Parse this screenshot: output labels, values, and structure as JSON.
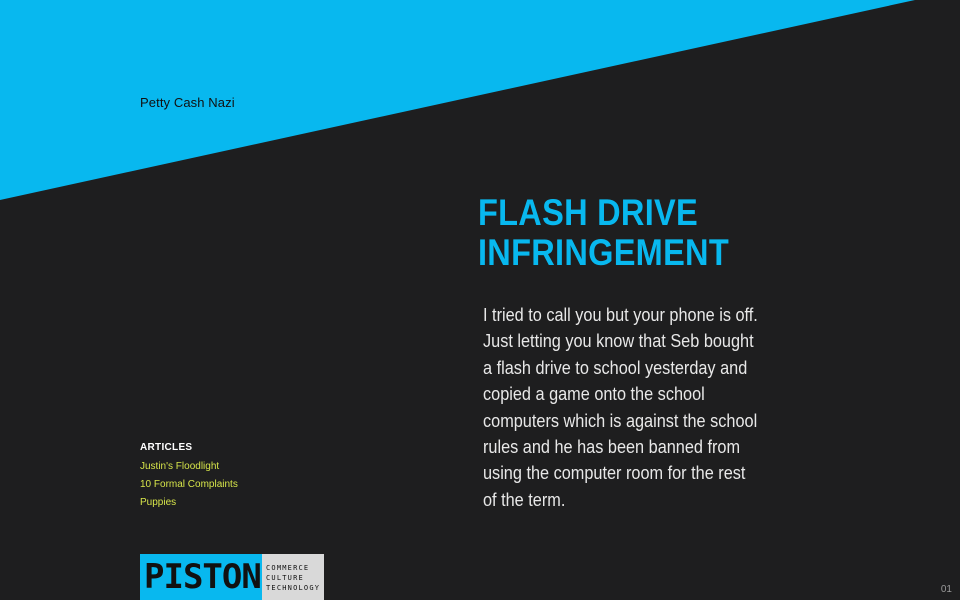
{
  "colors": {
    "background": "#1e1e1f",
    "accent": "#08b8ef",
    "link": "#d7e54a",
    "body_text": "#e8e8e8"
  },
  "header": {
    "section_name": "Petty Cash Nazi"
  },
  "article": {
    "headline": "FLASH DRIVE\nINFRINGEMENT",
    "body": "I tried to call you but your phone is off.\nJust letting you know that Seb bought\na flash drive to school yesterday and\ncopied a game onto the school\ncomputers which is against the school\nrules and he has been banned from\nusing the computer room for the rest\nof the term."
  },
  "sidebar": {
    "heading": "ARTICLES",
    "links": [
      {
        "label": "Justin's Floodlight"
      },
      {
        "label": "10 Formal Complaints"
      },
      {
        "label": "Puppies"
      }
    ]
  },
  "logo": {
    "wordmark": "PISTON",
    "tagline": [
      "COMMERCE",
      "CULTURE",
      "TECHNOLOGY"
    ]
  },
  "footer": {
    "page_number": "01"
  }
}
